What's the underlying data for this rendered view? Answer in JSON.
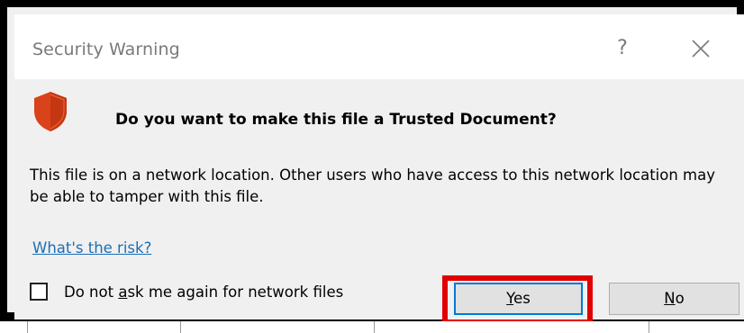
{
  "window": {
    "title": "Security Warning",
    "help_label": "?",
    "close_label": "×"
  },
  "dialog": {
    "heading": "Do you want to make this file a Trusted Document?",
    "message": "This file is on a network location. Other users who have access to this network location may be able to tamper with this file.",
    "risk_link": "What's the risk?",
    "checkbox": {
      "label_before": "Do not ",
      "label_accel": "a",
      "label_after": "sk me again for network files",
      "checked": false
    },
    "buttons": {
      "yes_accel": "Y",
      "yes_rest": "es",
      "no_accel": "N",
      "no_rest": "o"
    }
  },
  "icons": {
    "shield": "shield-icon",
    "close": "close-icon"
  },
  "colors": {
    "shield": "#d9421a",
    "link": "#1a6fb5",
    "highlight": "#e10000",
    "dialog_bg": "#f0f0f0",
    "focus_border": "#0078d7"
  }
}
